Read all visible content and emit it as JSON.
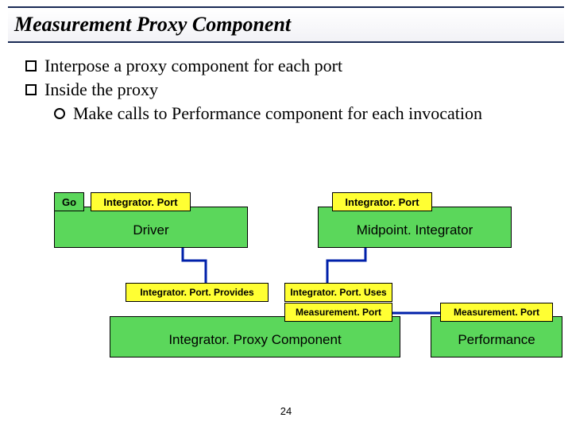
{
  "title": "Measurement Proxy Component",
  "bullets": {
    "b1a": "Interpose a proxy component for each port",
    "b1b": "Inside the proxy",
    "b2a": "Make calls to Performance component for each invocation"
  },
  "diagram": {
    "go": "Go",
    "intPort1": "Integrator. Port",
    "driver": "Driver",
    "intPort2": "Integrator. Port",
    "midpoint": "Midpoint. Integrator",
    "provides": "Integrator. Port. Provides",
    "uses": "Integrator. Port. Uses",
    "mport1": "Measurement. Port",
    "proxy": "Integrator. Proxy Component",
    "mport2": "Measurement. Port",
    "performance": "Performance"
  },
  "page": "24"
}
